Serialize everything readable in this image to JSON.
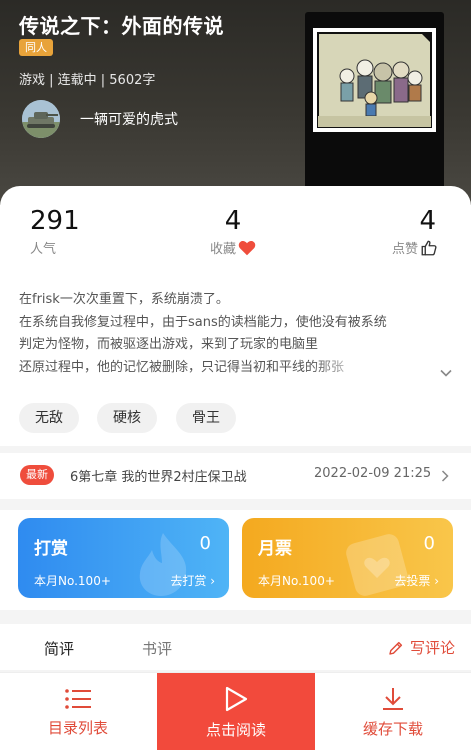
{
  "book": {
    "title": "传说之下：外面的传说",
    "tag": "同人",
    "meta": "游戏 | 连载中 | 5602字",
    "author": "一辆可爱的虎式"
  },
  "stats": {
    "popularity": {
      "value": "291",
      "label": "人气"
    },
    "favorites": {
      "value": "4",
      "label": "收藏"
    },
    "likes": {
      "value": "4",
      "label": "点赞"
    }
  },
  "summary": {
    "lines": [
      "在frisk一次次重置下，系统崩溃了。",
      "在系统自我修复过程中，由于sans的读档能力，使他没有被系统",
      "判定为怪物，而被驱逐出游戏，来到了玩家的电脑里",
      "还原过程中，他的记忆被删除，只记得当初和平线的那张"
    ]
  },
  "tags": [
    "无敌",
    "硬核",
    "骨王"
  ],
  "latest": {
    "badge": "最新",
    "chapter": "6第七章 我的世界2村庄保卫战",
    "time": "2022-02-09 21:25"
  },
  "gifts": {
    "reward": {
      "title": "打赏",
      "count": "0",
      "rank": "本月No.100+",
      "action": "去打赏"
    },
    "ticket": {
      "title": "月票",
      "count": "0",
      "rank": "本月No.100+",
      "action": "去投票"
    }
  },
  "tabs": {
    "short": "简评",
    "long": "书评",
    "write": "写评论"
  },
  "bottom": {
    "catalog": "目录列表",
    "read": "点击阅读",
    "download": "缓存下载"
  },
  "colors": {
    "accent": "#f24a3c",
    "tag": "#e8a33a",
    "blue": "#2f8bf0",
    "yellow": "#f4a91f"
  },
  "icons": [
    "heart-icon",
    "thumbs-up-icon",
    "chevron-down-icon",
    "chevron-right-icon",
    "pencil-icon",
    "list-icon",
    "play-icon",
    "download-icon"
  ]
}
